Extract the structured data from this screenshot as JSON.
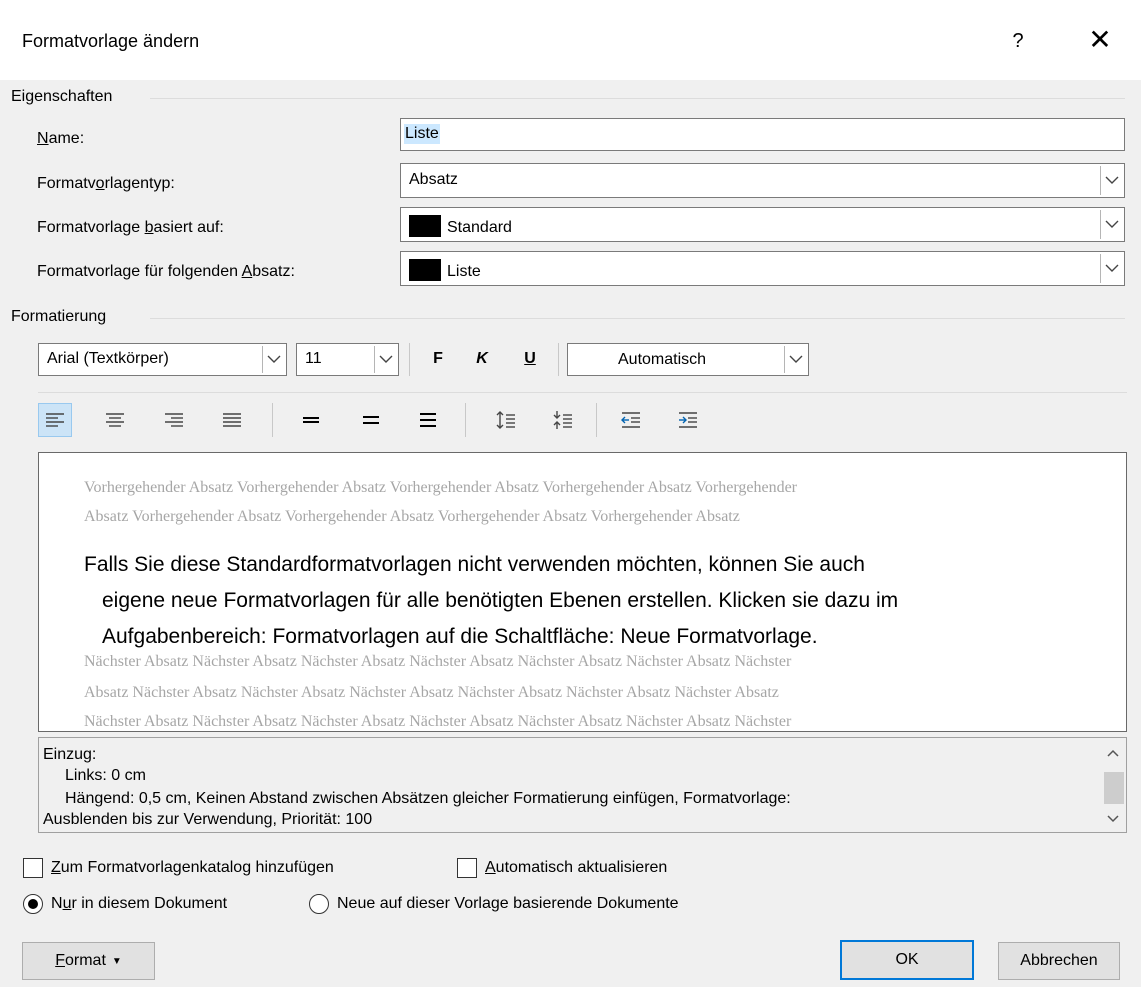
{
  "window": {
    "title": "Formatvorlage ändern",
    "help": "?",
    "close": "✕"
  },
  "eigenschaften": {
    "group_label": "Eigenschaften",
    "name_label_pre": "",
    "name_label_u": "N",
    "name_label_post": "ame:",
    "name_value": "Liste",
    "typ_label_pre": "Formatv",
    "typ_label_u": "o",
    "typ_label_post": "rlagentyp:",
    "typ_value": "Absatz",
    "basis_label_pre": "Formatvorlage ",
    "basis_label_u": "b",
    "basis_label_post": "asiert auf:",
    "basis_value": "Standard",
    "folgend_label_pre": "Formatvorlage für folgenden ",
    "folgend_label_u": "A",
    "folgend_label_post": "bsatz:",
    "folgend_value": "Liste"
  },
  "formatierung": {
    "group_label": "Formatierung",
    "font": "Arial (Textkörper)",
    "size": "11",
    "bold": "F",
    "italic": "K",
    "underline": "U",
    "color": "Automatisch"
  },
  "preview": {
    "prev1": "Vorhergehender Absatz Vorhergehender Absatz Vorhergehender Absatz Vorhergehender Absatz Vorhergehender",
    "prev2": "Absatz Vorhergehender Absatz Vorhergehender Absatz Vorhergehender Absatz Vorhergehender Absatz",
    "sample1": "Falls Sie diese Standardformatvorlagen nicht verwenden möchten, können Sie auch",
    "sample2": "eigene neue Formatvorlagen für alle benötigten Ebenen erstellen. Klicken sie dazu im",
    "sample3": "Aufgabenbereich: Formatvorlagen auf die Schaltfläche: Neue Formatvorlage.",
    "next1": "Nächster Absatz Nächster Absatz Nächster Absatz Nächster Absatz Nächster Absatz Nächster Absatz Nächster",
    "next2": "Absatz Nächster Absatz Nächster Absatz Nächster Absatz Nächster Absatz Nächster Absatz Nächster Absatz",
    "next3": "Nächster Absatz Nächster Absatz Nächster Absatz Nächster Absatz Nächster Absatz Nächster Absatz Nächster"
  },
  "description": {
    "l1": "Einzug:",
    "l2": "Links:  0 cm",
    "l3": "Hängend:  0,5 cm, Keinen Abstand zwischen Absätzen gleicher Formatierung einfügen, Formatvorlage:",
    "l4": "Ausblenden bis zur Verwendung, Priorität: 100"
  },
  "options": {
    "katalog_u": "Z",
    "katalog_rest": "um Formatvorlagenkatalog hinzufügen",
    "auto_u": "A",
    "auto_rest": "utomatisch aktualisieren",
    "nur_pre": "N",
    "nur_u": "u",
    "nur_post": "r in diesem Dokument",
    "neue": "Neue auf dieser Vorlage basierende Dokumente"
  },
  "buttons": {
    "format_u": "F",
    "format_rest": "ormat",
    "ok": "OK",
    "cancel": "Abbrechen"
  }
}
